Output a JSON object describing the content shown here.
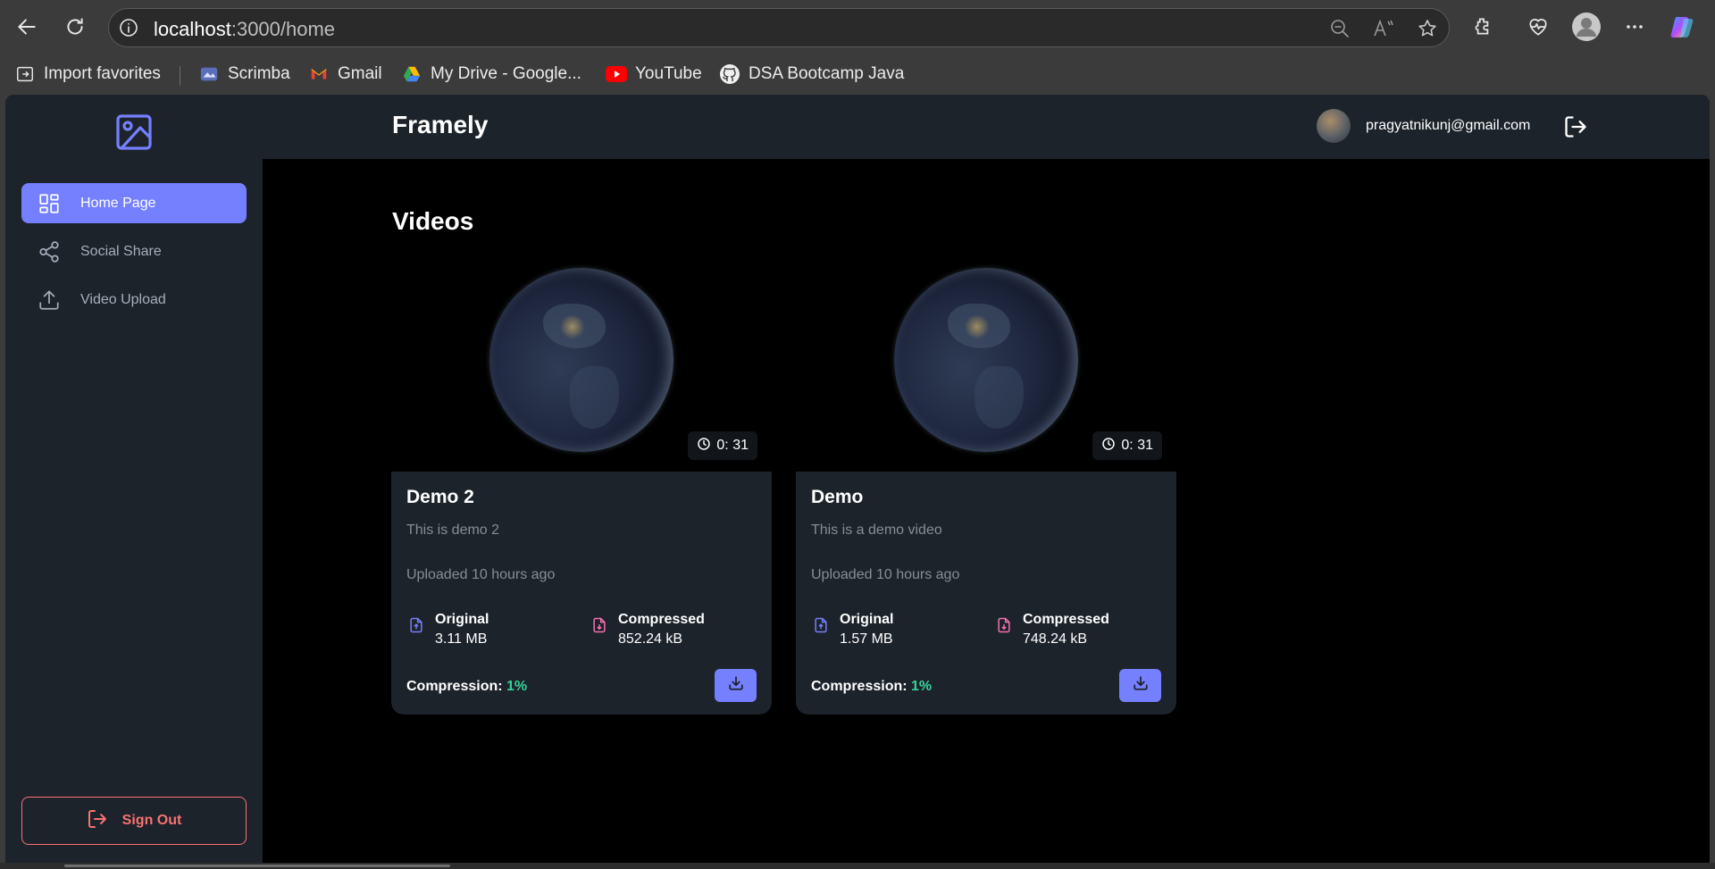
{
  "browser": {
    "url_host": "localhost",
    "url_path": ":3000/home",
    "bookmarks": [
      {
        "label": "Import favorites",
        "icon": "import-icon"
      },
      {
        "label": "Scrimba",
        "icon": "scrimba-icon"
      },
      {
        "label": "Gmail",
        "icon": "gmail-icon"
      },
      {
        "label": "My Drive - Google...",
        "icon": "google-drive-icon"
      },
      {
        "label": "YouTube",
        "icon": "youtube-icon"
      },
      {
        "label": "DSA Bootcamp Java",
        "icon": "github-icon"
      }
    ]
  },
  "sidebar": {
    "items": [
      {
        "label": "Home Page",
        "icon": "grid-icon",
        "active": true
      },
      {
        "label": "Social Share",
        "icon": "share-icon",
        "active": false
      },
      {
        "label": "Video Upload",
        "icon": "upload-icon",
        "active": false
      }
    ],
    "signout_label": "Sign Out"
  },
  "header": {
    "brand": "Framely",
    "email": "pragyatnikunj@gmail.com"
  },
  "main": {
    "title": "Videos",
    "videos": [
      {
        "title": "Demo 2",
        "description": "This is demo 2",
        "uploaded": "Uploaded 10 hours ago",
        "duration": "0: 31",
        "original_label": "Original",
        "original_size": "3.11 MB",
        "compressed_label": "Compressed",
        "compressed_size": "852.24 kB",
        "compression_label": "Compression:",
        "compression_value": "1%"
      },
      {
        "title": "Demo",
        "description": "This is a demo video",
        "uploaded": "Uploaded 10 hours ago",
        "duration": "0: 31",
        "original_label": "Original",
        "original_size": "1.57 MB",
        "compressed_label": "Compressed",
        "compressed_size": "748.24 kB",
        "compression_label": "Compression:",
        "compression_value": "1%"
      }
    ]
  },
  "colors": {
    "accent": "#7480ff",
    "success": "#36d399",
    "danger": "#f87272",
    "panel": "#1d232a"
  }
}
